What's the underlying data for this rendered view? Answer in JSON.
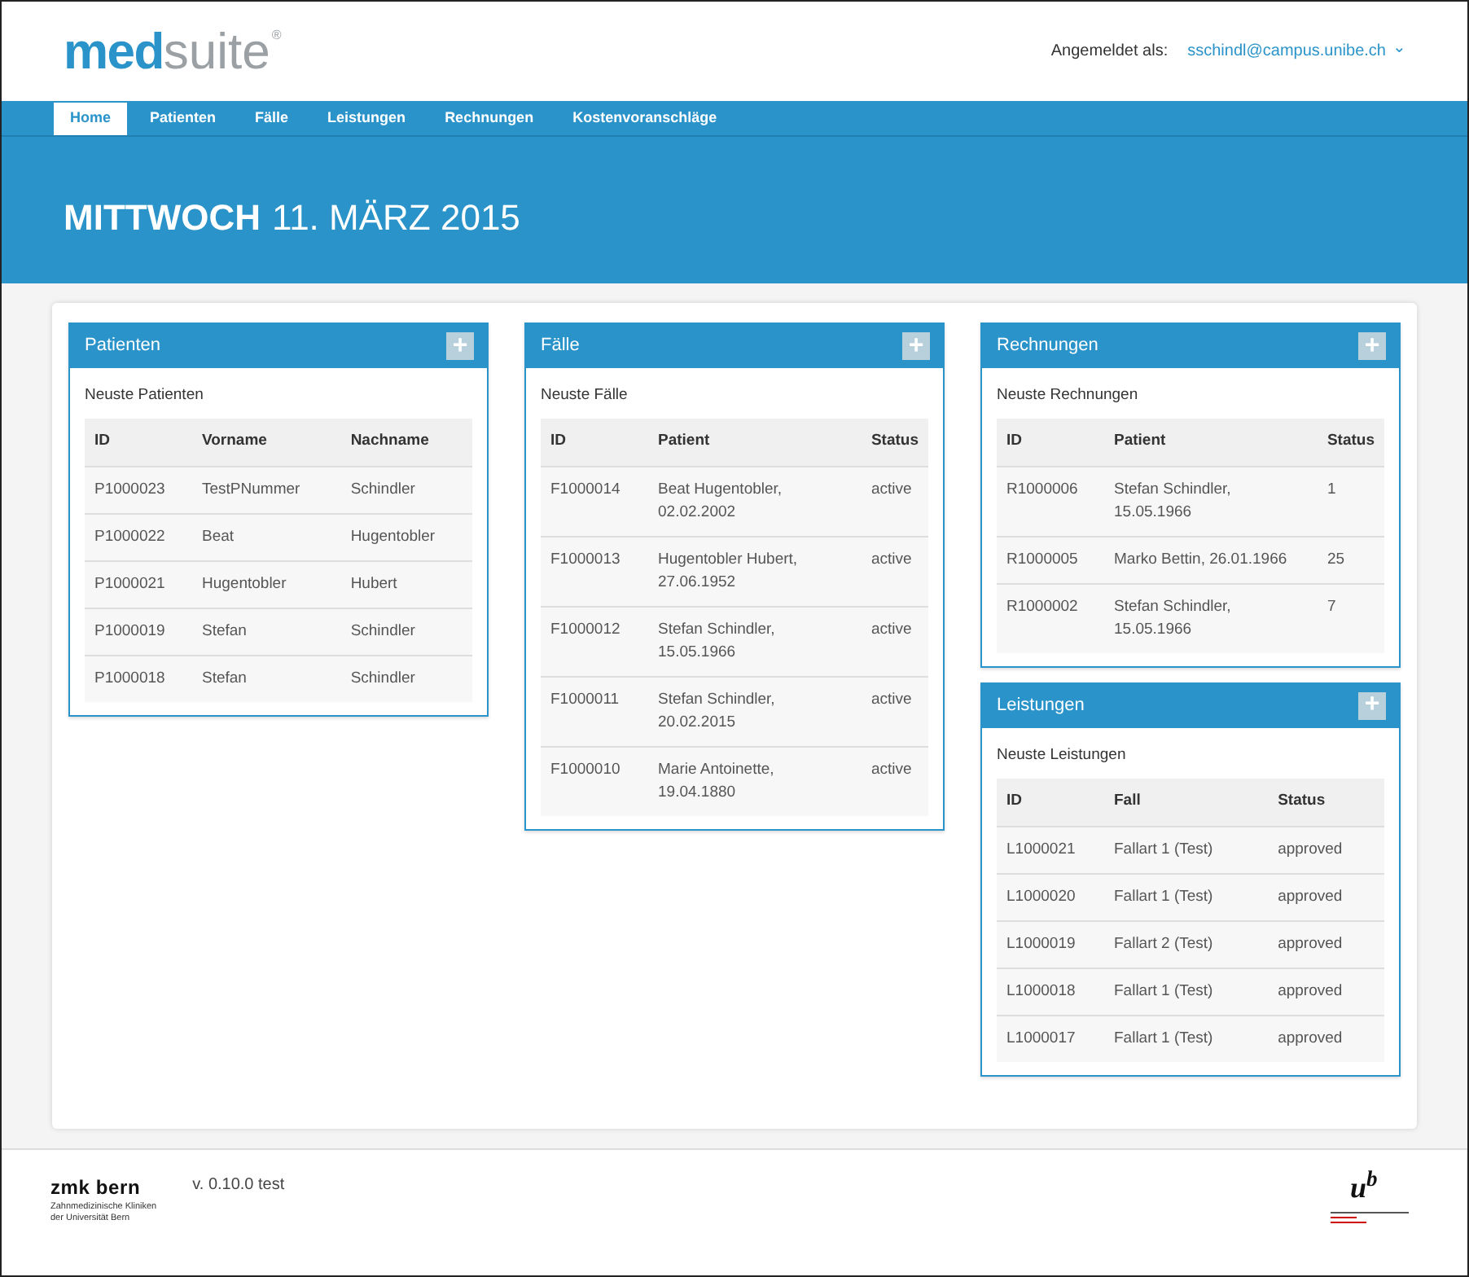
{
  "logo": {
    "bold": "med",
    "light": "suite",
    "mark": "®"
  },
  "user": {
    "label": "Angemeldet als:",
    "email": "sschindl@campus.unibe.ch",
    "caret": "⌄"
  },
  "nav": [
    {
      "label": "Home",
      "selected": true
    },
    {
      "label": "Patienten",
      "selected": false
    },
    {
      "label": "Fälle",
      "selected": false
    },
    {
      "label": "Leistungen",
      "selected": false
    },
    {
      "label": "Rechnungen",
      "selected": false
    },
    {
      "label": "Kostenvoranschläge",
      "selected": false
    }
  ],
  "date_title": {
    "weekday": "MITTWOCH",
    "date": "11. MÄRZ 2015"
  },
  "columns": [
    [
      {
        "title": "Patienten",
        "add": "+",
        "subtitle": "Neuste Patienten",
        "headers": [
          "ID",
          "Vorname",
          "Nachname"
        ],
        "rows": [
          [
            "P1000023",
            "TestPNummer",
            "Schindler"
          ],
          [
            "P1000022",
            "Beat",
            "Hugentobler"
          ],
          [
            "P1000021",
            "Hugentobler",
            "Hubert"
          ],
          [
            "P1000019",
            "Stefan",
            "Schindler"
          ],
          [
            "P1000018",
            "Stefan",
            "Schindler"
          ]
        ]
      }
    ],
    [
      {
        "title": "Fälle",
        "add": "+",
        "subtitle": "Neuste Fälle",
        "headers": [
          "ID",
          "Patient",
          "Status"
        ],
        "rows": [
          [
            "F1000014",
            "Beat Hugentobler, 02.02.2002",
            "active"
          ],
          [
            "F1000013",
            "Hugentobler Hubert, 27.06.1952",
            "active"
          ],
          [
            "F1000012",
            "Stefan Schindler, 15.05.1966",
            "active"
          ],
          [
            "F1000011",
            "Stefan Schindler, 20.02.2015",
            "active"
          ],
          [
            "F1000010",
            "Marie Antoinette, 19.04.1880",
            "active"
          ]
        ]
      }
    ],
    [
      {
        "title": "Rechnungen",
        "add": "+",
        "subtitle": "Neuste Rechnungen",
        "headers": [
          "ID",
          "Patient",
          "Status"
        ],
        "rows": [
          [
            "R1000006",
            "Stefan Schindler, 15.05.1966",
            "1"
          ],
          [
            "R1000005",
            "Marko Bettin, 26.01.1966",
            "25"
          ],
          [
            "R1000002",
            "Stefan Schindler, 15.05.1966",
            "7"
          ]
        ]
      },
      {
        "title": "Leistungen",
        "add": "+",
        "subtitle": "Neuste Leistungen",
        "headers": [
          "ID",
          "Fall",
          "Status"
        ],
        "rows": [
          [
            "L1000021",
            "Fallart 1 (Test)",
            "approved"
          ],
          [
            "L1000020",
            "Fallart 1 (Test)",
            "approved"
          ],
          [
            "L1000019",
            "Fallart 2 (Test)",
            "approved"
          ],
          [
            "L1000018",
            "Fallart 1 (Test)",
            "approved"
          ],
          [
            "L1000017",
            "Fallart 1 (Test)",
            "approved"
          ]
        ]
      }
    ]
  ],
  "footer": {
    "org": "zmk bern",
    "org_sub": [
      "Zahnmedizinische Kliniken",
      "der Universität Bern"
    ],
    "version": "v. 0.10.0 test",
    "uni_logo": "u$^{b}$"
  }
}
